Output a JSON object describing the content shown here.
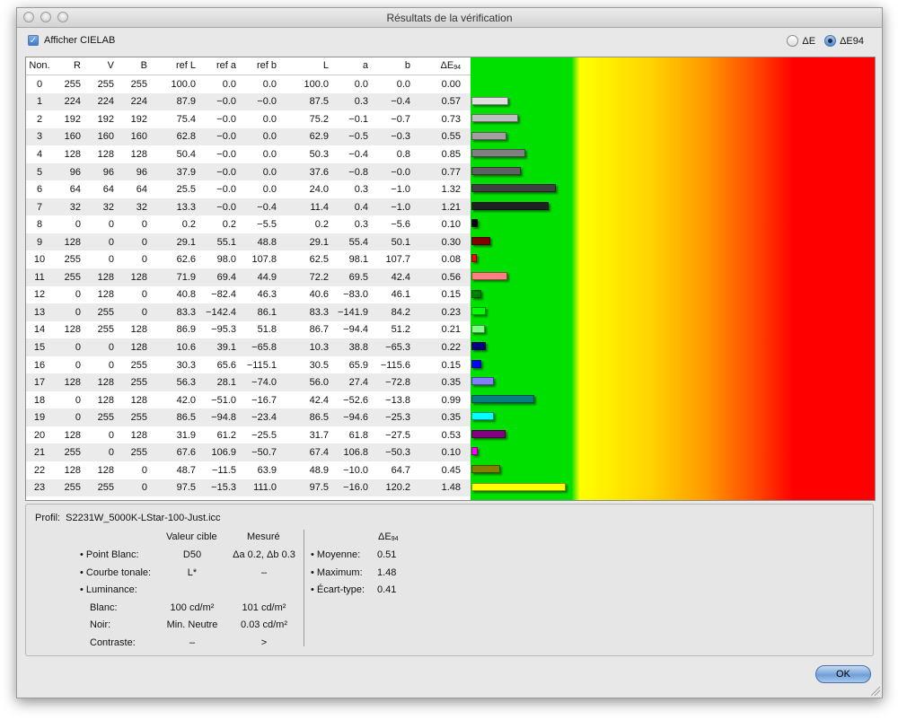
{
  "window": {
    "title": "Résultats de la vérification"
  },
  "options": {
    "show_cielab_label": "Afficher CIELAB",
    "show_cielab_checked": true,
    "radio_de_label": "ΔE",
    "radio_de94_label": "ΔE94",
    "selected": "ΔE94"
  },
  "table": {
    "headers": [
      "Non.",
      "R",
      "V",
      "B",
      "ref L",
      "ref a",
      "ref b",
      "L",
      "a",
      "b",
      "ΔE"
    ],
    "de_header_sub": "94",
    "rows": [
      [
        "0",
        "255",
        "255",
        "255",
        "100.0",
        "0.0",
        "0.0",
        "100.0",
        "0.0",
        "0.0",
        "0.00"
      ],
      [
        "1",
        "224",
        "224",
        "224",
        "87.9",
        "−0.0",
        "−0.0",
        "87.5",
        "0.3",
        "−0.4",
        "0.57"
      ],
      [
        "2",
        "192",
        "192",
        "192",
        "75.4",
        "−0.0",
        "0.0",
        "75.2",
        "−0.1",
        "−0.7",
        "0.73"
      ],
      [
        "3",
        "160",
        "160",
        "160",
        "62.8",
        "−0.0",
        "0.0",
        "62.9",
        "−0.5",
        "−0.3",
        "0.55"
      ],
      [
        "4",
        "128",
        "128",
        "128",
        "50.4",
        "−0.0",
        "0.0",
        "50.3",
        "−0.4",
        "0.8",
        "0.85"
      ],
      [
        "5",
        "96",
        "96",
        "96",
        "37.9",
        "−0.0",
        "0.0",
        "37.6",
        "−0.8",
        "−0.0",
        "0.77"
      ],
      [
        "6",
        "64",
        "64",
        "64",
        "25.5",
        "−0.0",
        "0.0",
        "24.0",
        "0.3",
        "−1.0",
        "1.32"
      ],
      [
        "7",
        "32",
        "32",
        "32",
        "13.3",
        "−0.0",
        "−0.4",
        "11.4",
        "0.4",
        "−1.0",
        "1.21"
      ],
      [
        "8",
        "0",
        "0",
        "0",
        "0.2",
        "0.2",
        "−5.5",
        "0.2",
        "0.3",
        "−5.6",
        "0.10"
      ],
      [
        "9",
        "128",
        "0",
        "0",
        "29.1",
        "55.1",
        "48.8",
        "29.1",
        "55.4",
        "50.1",
        "0.30"
      ],
      [
        "10",
        "255",
        "0",
        "0",
        "62.6",
        "98.0",
        "107.8",
        "62.5",
        "98.1",
        "107.7",
        "0.08"
      ],
      [
        "11",
        "255",
        "128",
        "128",
        "71.9",
        "69.4",
        "44.9",
        "72.2",
        "69.5",
        "42.4",
        "0.56"
      ],
      [
        "12",
        "0",
        "128",
        "0",
        "40.8",
        "−82.4",
        "46.3",
        "40.6",
        "−83.0",
        "46.1",
        "0.15"
      ],
      [
        "13",
        "0",
        "255",
        "0",
        "83.3",
        "−142.4",
        "86.1",
        "83.3",
        "−141.9",
        "84.2",
        "0.23"
      ],
      [
        "14",
        "128",
        "255",
        "128",
        "86.9",
        "−95.3",
        "51.8",
        "86.7",
        "−94.4",
        "51.2",
        "0.21"
      ],
      [
        "15",
        "0",
        "0",
        "128",
        "10.6",
        "39.1",
        "−65.8",
        "10.3",
        "38.8",
        "−65.3",
        "0.22"
      ],
      [
        "16",
        "0",
        "0",
        "255",
        "30.3",
        "65.6",
        "−115.1",
        "30.5",
        "65.9",
        "−115.6",
        "0.15"
      ],
      [
        "17",
        "128",
        "128",
        "255",
        "56.3",
        "28.1",
        "−74.0",
        "56.0",
        "27.4",
        "−72.8",
        "0.35"
      ],
      [
        "18",
        "0",
        "128",
        "128",
        "42.0",
        "−51.0",
        "−16.7",
        "42.4",
        "−52.6",
        "−13.8",
        "0.99"
      ],
      [
        "19",
        "0",
        "255",
        "255",
        "86.5",
        "−94.8",
        "−23.4",
        "86.5",
        "−94.6",
        "−25.3",
        "0.35"
      ],
      [
        "20",
        "128",
        "0",
        "128",
        "31.9",
        "61.2",
        "−25.5",
        "31.7",
        "61.8",
        "−27.5",
        "0.53"
      ],
      [
        "21",
        "255",
        "0",
        "255",
        "67.6",
        "106.9",
        "−50.7",
        "67.4",
        "106.8",
        "−50.3",
        "0.10"
      ],
      [
        "22",
        "128",
        "128",
        "0",
        "48.7",
        "−11.5",
        "63.9",
        "48.9",
        "−10.0",
        "64.7",
        "0.45"
      ],
      [
        "23",
        "255",
        "255",
        "0",
        "97.5",
        "−15.3",
        "111.0",
        "97.5",
        "−16.0",
        "120.2",
        "1.48"
      ]
    ],
    "bar_scale_de_max": 6.3,
    "bar_colors": [
      "#ffffff",
      "#e0e0e0",
      "#c0c0c0",
      "#a0a0a0",
      "#808080",
      "#606060",
      "#404040",
      "#202020",
      "#000000",
      "#800000",
      "#ff0000",
      "#ff8080",
      "#008000",
      "#00ff00",
      "#80ff80",
      "#000080",
      "#0000ff",
      "#8080ff",
      "#008080",
      "#00ffff",
      "#800080",
      "#ff00ff",
      "#808000",
      "#ffff00"
    ]
  },
  "info": {
    "profile_label": "Profil:",
    "profile_value": "S2231W_5000K-LStar-100-Just.icc",
    "col_target": "Valeur cible",
    "col_measured": "Mesuré",
    "col_de": "ΔE",
    "col_de_sub": "94",
    "white_point_label": "• Point Blanc:",
    "white_point_target": "D50",
    "white_point_measured": "Δa 0.2, Δb 0.3",
    "tone_curve_label": "• Courbe tonale:",
    "tone_curve_target": "L*",
    "tone_curve_measured": "–",
    "luminance_label": "• Luminance:",
    "white_label": "Blanc:",
    "white_target": "100 cd/m²",
    "white_measured": "101 cd/m²",
    "black_label": "Noir:",
    "black_target": "Min. Neutre",
    "black_measured": "0.03 cd/m²",
    "contrast_label": "Contraste:",
    "contrast_target": "–",
    "contrast_measured": ">",
    "mean_label": "• Moyenne:",
    "mean_value": "0.51",
    "max_label": "• Maximum:",
    "max_value": "1.48",
    "std_label": "• Écart-type:",
    "std_value": "0.41"
  },
  "buttons": {
    "ok_label": "OK"
  }
}
